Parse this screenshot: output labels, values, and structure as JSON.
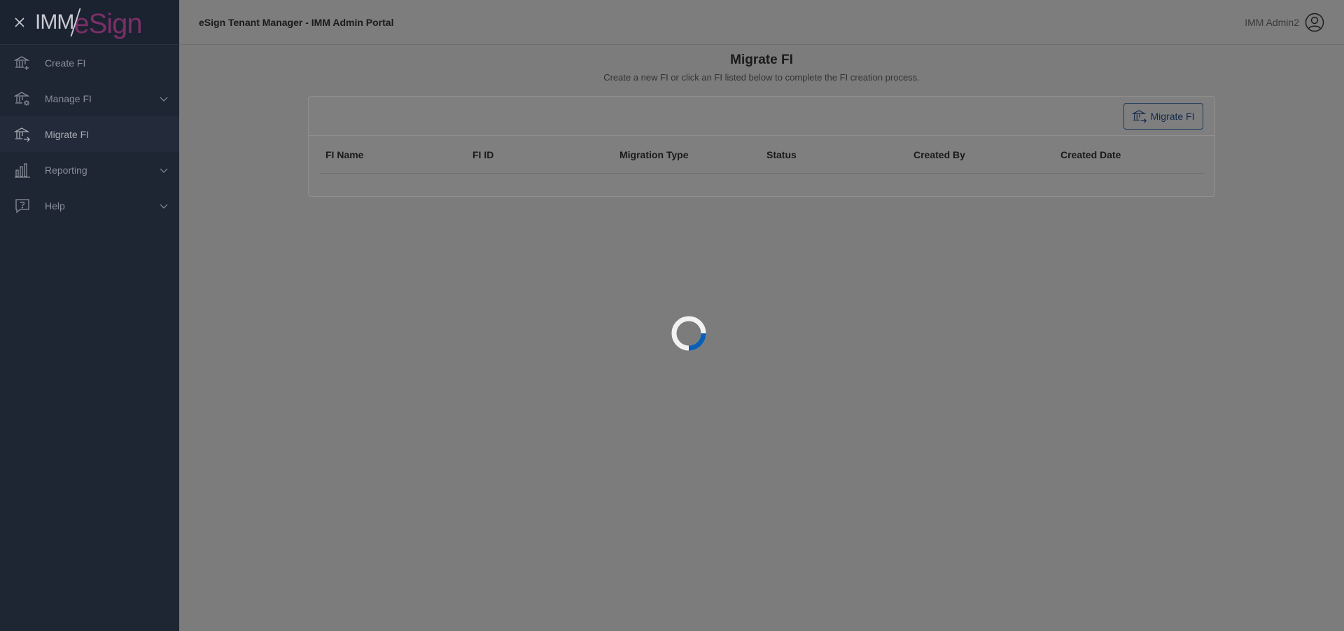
{
  "sidebar": {
    "logo_left": "IMM",
    "logo_right": "eSign",
    "items": [
      {
        "label": "Create FI",
        "icon": "bank-plus-icon",
        "expandable": false
      },
      {
        "label": "Manage FI",
        "icon": "bank-gear-icon",
        "expandable": true
      },
      {
        "label": "Migrate FI",
        "icon": "bank-arrow-icon",
        "expandable": false,
        "active": true
      },
      {
        "label": "Reporting",
        "icon": "bar-chart-icon",
        "expandable": true
      },
      {
        "label": "Help",
        "icon": "help-bubble-icon",
        "expandable": true
      }
    ]
  },
  "header": {
    "title": "eSign Tenant Manager - IMM Admin Portal",
    "user_name": "IMM Admin2"
  },
  "main": {
    "title": "Migrate FI",
    "subtitle": "Create a new FI or click an FI listed below to complete the FI creation process.",
    "migrate_button_label": "Migrate FI",
    "columns": [
      "FI Name",
      "FI ID",
      "Migration Type",
      "Status",
      "Created By",
      "Created Date"
    ]
  },
  "colors": {
    "sidebar_bg": "#1e2533",
    "overlay_gray": "#7c7c7c",
    "accent_blue": "#0a5fb4",
    "logo_purple": "#7a2f68"
  }
}
